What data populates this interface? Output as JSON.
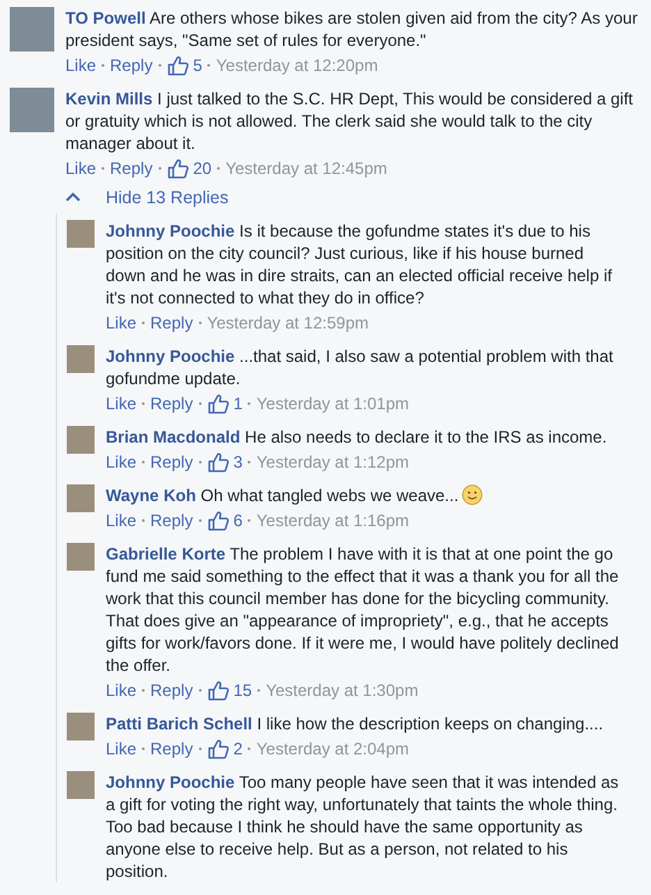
{
  "comments": [
    {
      "author": "TO Powell",
      "text": "Are others whose bikes are stolen given aid from the city? As your president says, \"Same set of rules for everyone.\"",
      "like": "Like",
      "reply": "Reply",
      "likes": "5",
      "time": "Yesterday at 12:20pm"
    },
    {
      "author": "Kevin Mills",
      "text": "I just talked to the S.C. HR Dept, This would be considered a gift or gratuity which is not allowed. The clerk said she would talk to the city manager about it.",
      "like": "Like",
      "reply": "Reply",
      "likes": "20",
      "time": "Yesterday at 12:45pm"
    }
  ],
  "replies_toggle": {
    "label": "Hide 13 Replies",
    "expanded": true
  },
  "replies": [
    {
      "author": "Johnny Poochie",
      "text": "Is it because the gofundme states it's due to his position on the city council? Just curious, like if his house burned down and he was in dire straits, can an elected official receive help if it's not connected to what they do in office?",
      "like": "Like",
      "reply": "Reply",
      "time": "Yesterday at 12:59pm"
    },
    {
      "author": "Johnny Poochie",
      "text": "...that said, I also saw a potential problem with that gofundme update.",
      "like": "Like",
      "reply": "Reply",
      "likes": "1",
      "time": "Yesterday at 1:01pm"
    },
    {
      "author": "Brian Macdonald",
      "text": "He also needs to declare it to the IRS as income.",
      "like": "Like",
      "reply": "Reply",
      "likes": "3",
      "time": "Yesterday at 1:12pm"
    },
    {
      "author": "Wayne Koh",
      "text": "Oh what tangled webs we weave...",
      "emoji": true,
      "like": "Like",
      "reply": "Reply",
      "likes": "6",
      "time": "Yesterday at 1:16pm"
    },
    {
      "author": "Gabrielle Korte",
      "text": "The problem I have with it is that at one point the go fund me said something to the effect that it was a thank you for all the work that this council member has done for the bicycling community. That does give an \"appearance of impropriety\", e.g., that he accepts gifts for work/favors done. If it were me, I would have politely declined the offer.",
      "like": "Like",
      "reply": "Reply",
      "likes": "15",
      "time": "Yesterday at 1:30pm"
    },
    {
      "author": "Patti Barich Schell",
      "text": "I like how the description keeps on changing....",
      "like": "Like",
      "reply": "Reply",
      "likes": "2",
      "time": "Yesterday at 2:04pm"
    },
    {
      "author": "Johnny Poochie",
      "text": "Too many people have seen that it was intended as a gift for voting the right way, unfortunately that taints the whole thing. Too bad because I think he should have the same opportunity as anyone else to receive help. But as a person, not related to his position."
    }
  ]
}
